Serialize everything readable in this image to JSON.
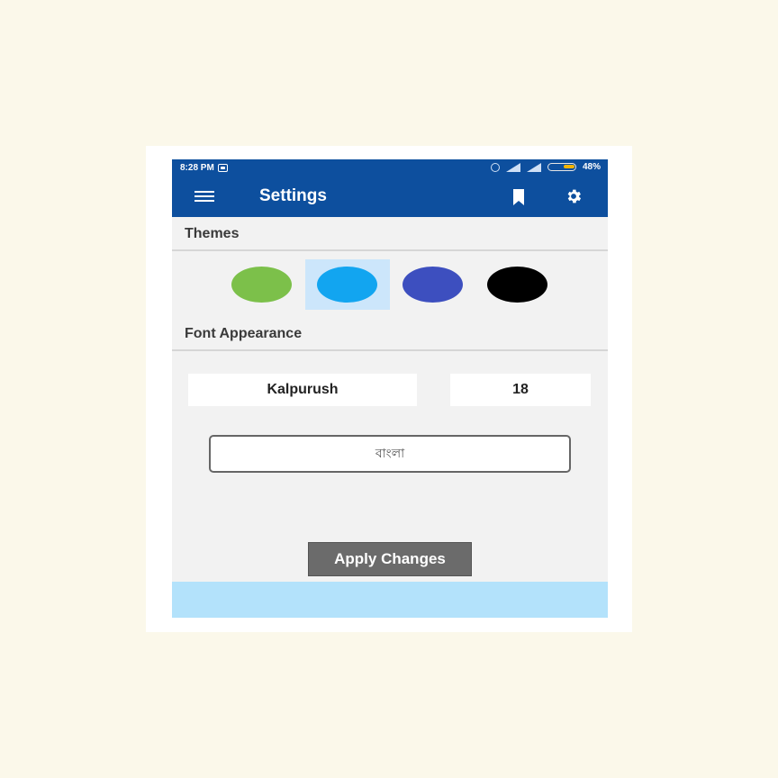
{
  "status_bar": {
    "time": "8:28 PM",
    "battery": "48%"
  },
  "app_bar": {
    "title": "Settings",
    "menu_icon": "hamburger-menu-icon",
    "bookmark_icon": "bookmark-icon",
    "settings_icon": "gear-icon"
  },
  "colors": {
    "app_bar": "#0d4f9e",
    "selected_highlight": "#cce6fb",
    "bottom_bar": "#b3e2fb",
    "apply_button": "#6b6b6b"
  },
  "themes": {
    "label": "Themes",
    "swatches": [
      {
        "name": "green",
        "color": "#7cc04a",
        "selected": false
      },
      {
        "name": "light-blue",
        "color": "#12a5f0",
        "selected": true
      },
      {
        "name": "indigo",
        "color": "#3d4fbf",
        "selected": false
      },
      {
        "name": "black",
        "color": "#000000",
        "selected": false
      }
    ]
  },
  "font_appearance": {
    "label": "Font Appearance",
    "font_name": "Kalpurush",
    "font_size": "18",
    "preview_text": "বাংলা"
  },
  "actions": {
    "apply_label": "Apply Changes"
  }
}
